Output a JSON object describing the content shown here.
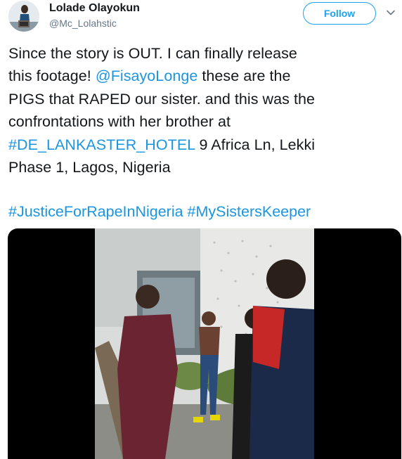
{
  "user": {
    "display_name": "Lolade Olayokun",
    "handle": "@Mc_Lolahstic"
  },
  "follow_label": "Follow",
  "tweet": {
    "lines": [
      [
        {
          "t": "Since the story is OUT. I can finally release",
          "link": false
        }
      ],
      [
        {
          "t": "this footage! ",
          "link": false
        },
        {
          "t": "@FisayoLonge",
          "link": true
        },
        {
          "t": " these are the",
          "link": false
        }
      ],
      [
        {
          "t": "PIGS that RAPED our sister. and this was the",
          "link": false
        }
      ],
      [
        {
          "t": "confrontations with her brother at",
          "link": false
        }
      ],
      [
        {
          "t": "#DE_LANKASTER_HOTEL",
          "link": true
        },
        {
          "t": " 9 Africa Ln, Lekki",
          "link": false
        }
      ],
      [
        {
          "t": "Phase 1, Lagos, Nigeria",
          "link": false
        }
      ]
    ],
    "hashtag_1": "#JusticeForRapeInNigeria",
    "hashtag_2": "#MySistersKeeper"
  },
  "icons": {
    "caret": "chevron-down-icon"
  },
  "colors": {
    "link": "#1b95e0",
    "follow": "#1da1f2",
    "text": "#14171a",
    "secondary": "#657786"
  }
}
